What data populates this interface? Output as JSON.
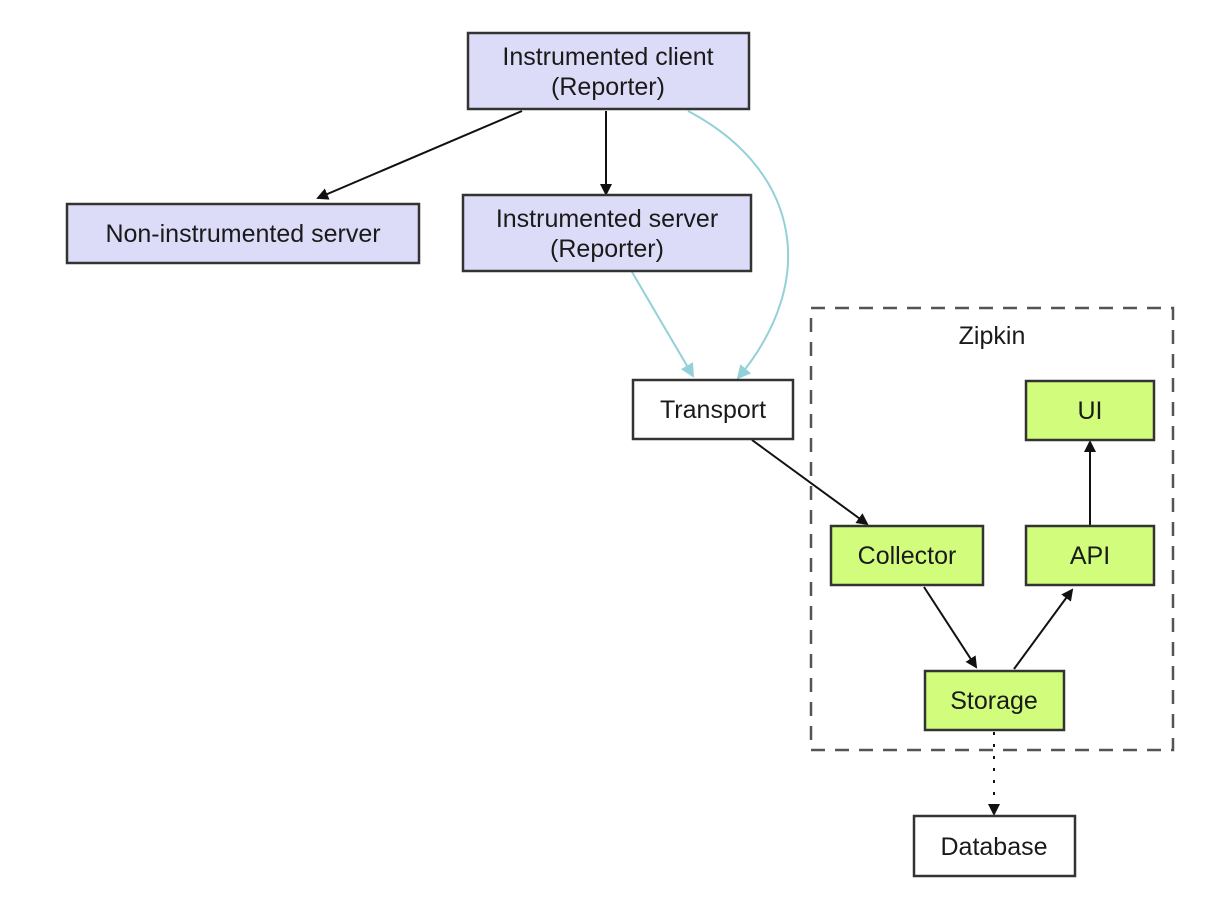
{
  "diagram": {
    "cluster": {
      "label": "Zipkin"
    },
    "nodes": {
      "client": {
        "lines": [
          "Instrumented client",
          "(Reporter)"
        ],
        "style": "blue"
      },
      "noninstr": {
        "lines": [
          "Non-instrumented server"
        ],
        "style": "blue"
      },
      "server": {
        "lines": [
          "Instrumented server",
          "(Reporter)"
        ],
        "style": "blue"
      },
      "transport": {
        "lines": [
          "Transport"
        ],
        "style": "white"
      },
      "ui": {
        "lines": [
          "UI"
        ],
        "style": "green"
      },
      "collector": {
        "lines": [
          "Collector"
        ],
        "style": "green"
      },
      "api": {
        "lines": [
          "API"
        ],
        "style": "green"
      },
      "storage": {
        "lines": [
          "Storage"
        ],
        "style": "green"
      },
      "database": {
        "lines": [
          "Database"
        ],
        "style": "white"
      }
    },
    "edges": [
      {
        "from": "client",
        "to": "noninstr",
        "style": "solid",
        "color": "black"
      },
      {
        "from": "client",
        "to": "server",
        "style": "solid",
        "color": "black"
      },
      {
        "from": "client",
        "to": "transport",
        "style": "solid",
        "color": "cyan"
      },
      {
        "from": "server",
        "to": "transport",
        "style": "solid",
        "color": "cyan"
      },
      {
        "from": "transport",
        "to": "collector",
        "style": "solid",
        "color": "black"
      },
      {
        "from": "collector",
        "to": "storage",
        "style": "solid",
        "color": "black"
      },
      {
        "from": "storage",
        "to": "api",
        "style": "solid",
        "color": "black"
      },
      {
        "from": "api",
        "to": "ui",
        "style": "solid",
        "color": "black"
      },
      {
        "from": "storage",
        "to": "database",
        "style": "dotted",
        "color": "black"
      }
    ],
    "colors": {
      "instrumented_fill": "#dcdcf8",
      "zipkin_fill": "#d1fc7c",
      "plain_fill": "#ffffff",
      "reporter_edge": "#93d0d8",
      "edge": "#111111"
    }
  }
}
